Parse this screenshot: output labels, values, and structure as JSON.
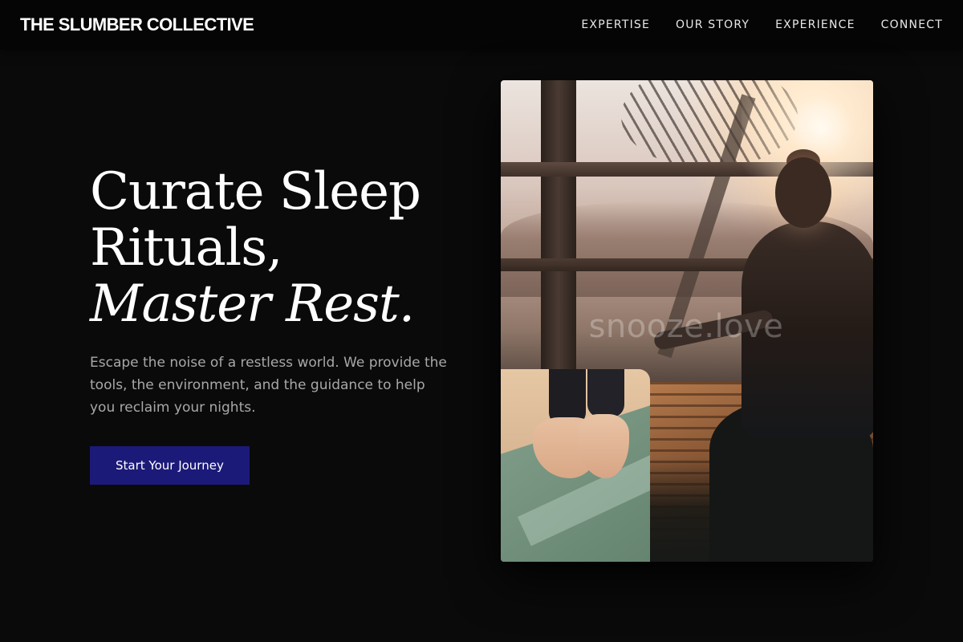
{
  "header": {
    "brand": "THE SLUMBER COLLECTIVE",
    "nav": [
      {
        "label": "EXPERTISE"
      },
      {
        "label": "OUR STORY"
      },
      {
        "label": "EXPERIENCE"
      },
      {
        "label": "CONNECT"
      }
    ]
  },
  "hero": {
    "headline_line1": "Curate Sleep",
    "headline_line2": "Rituals,",
    "headline_line3": "Master Rest.",
    "subtext": "Escape the noise of a restless world. We provide the tools, the environment, and the guidance to help you reclaim your nights.",
    "cta_label": "Start Your Journey"
  },
  "media": {
    "main_photo": "meditation-at-sunset",
    "inset_photo": "bare-feet-on-yoga-mat",
    "watermark": "snooze.love"
  },
  "colors": {
    "background": "#0a0a0a",
    "topbar": "#050505",
    "cta_background": "#1c1a78",
    "body_text": "#a8a8a8"
  }
}
